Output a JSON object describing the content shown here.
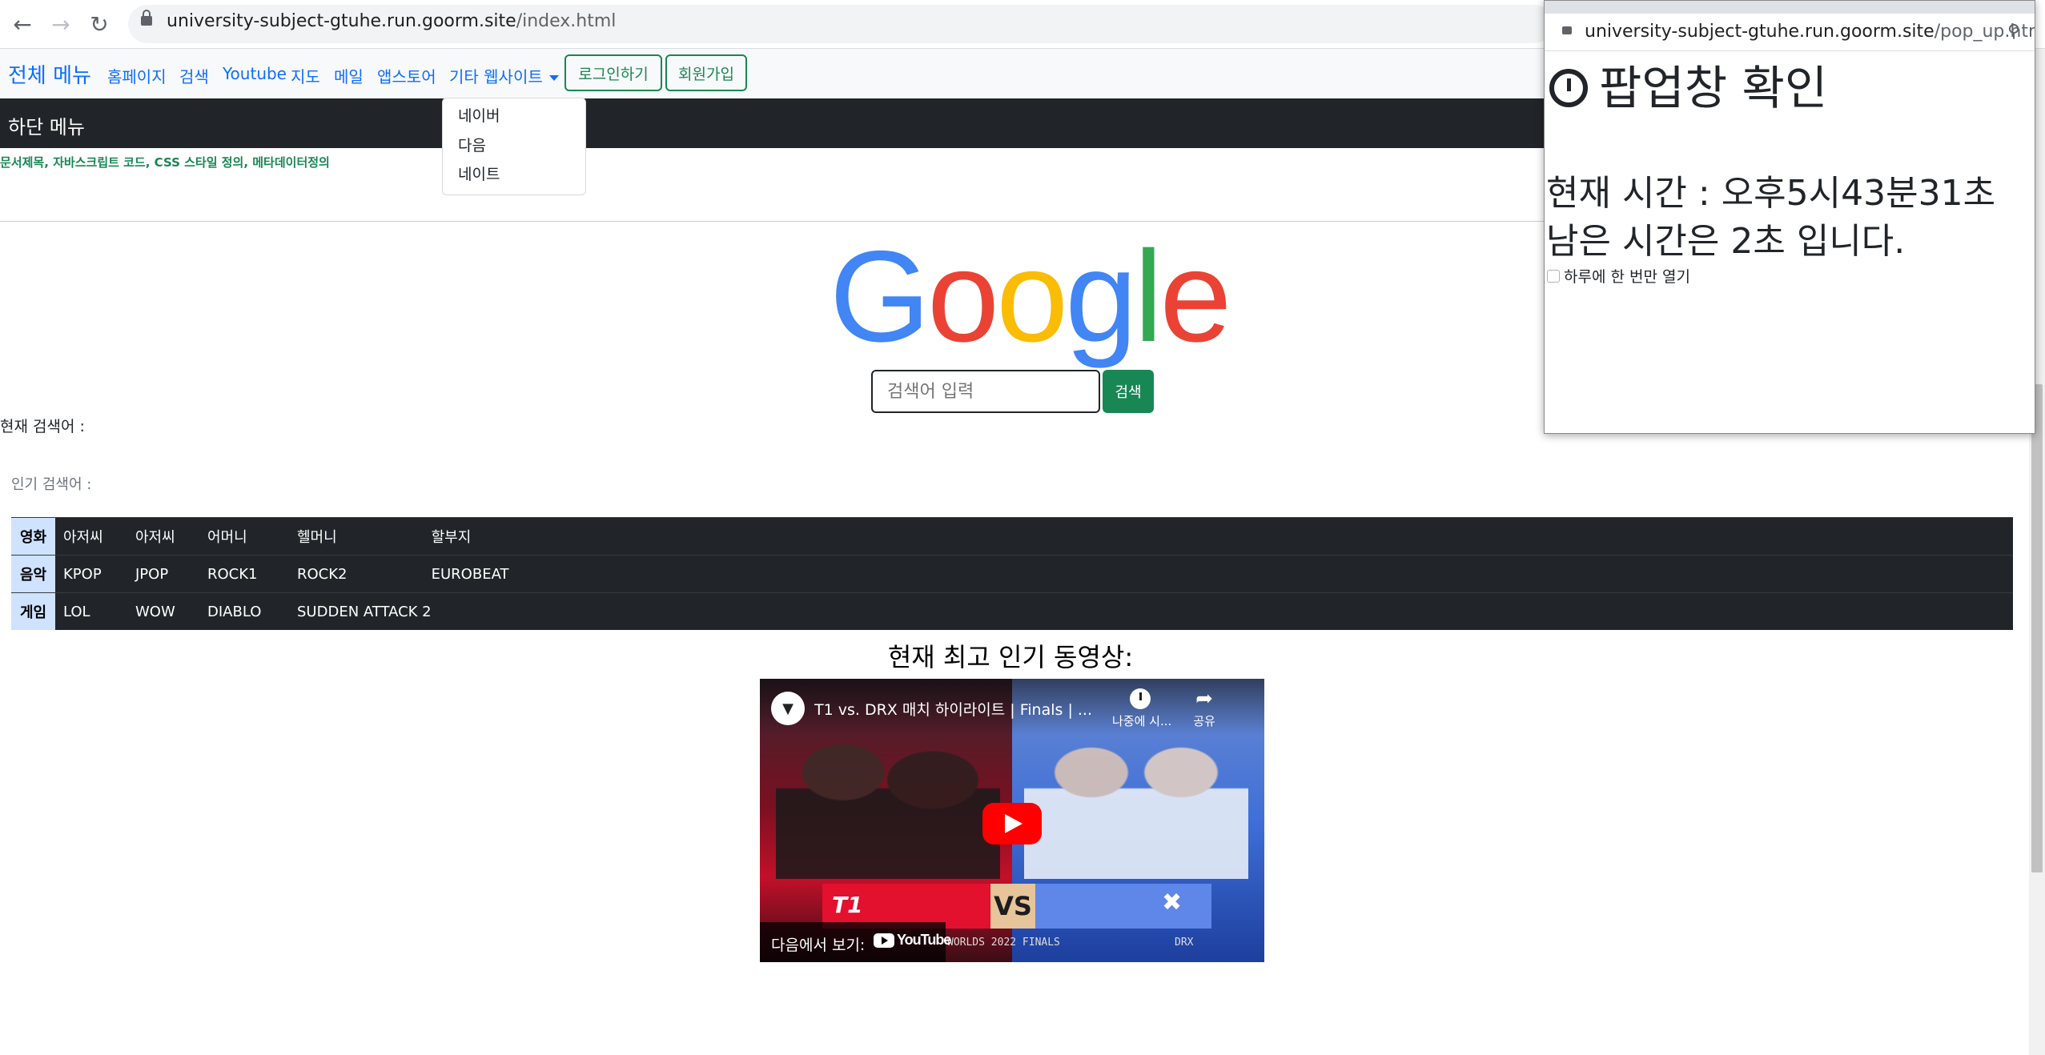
{
  "browser": {
    "url_host": "university-subject-gtuhe.run.goorm.site",
    "url_path": "/index.html"
  },
  "navbar": {
    "brand": "전체 메뉴",
    "links": [
      "홈페이지",
      "검색",
      "Youtube",
      "지도",
      "메일",
      "앱스토어"
    ],
    "dropdown_label": "기타 웹사이트",
    "login_button": "로그인하기",
    "signup_button": "회원가입",
    "dropdown_items": [
      "네이버",
      "다음",
      "네이트"
    ]
  },
  "dark_bar": {
    "title": "하단 메뉴"
  },
  "meta_text": "문서제목, 자바스크립트 코드, CSS 스타일 정의, 메타데이터정의",
  "google_logo": {
    "letters": [
      "G",
      "o",
      "o",
      "g",
      "l",
      "e"
    ],
    "colors": [
      "#4285F4",
      "#EA4335",
      "#FBBC05",
      "#4285F4",
      "#34A853",
      "#EA4335"
    ]
  },
  "search": {
    "placeholder": "검색어 입력",
    "button": "검색"
  },
  "current_keyword_label": "현재 검색어 :",
  "popular_keyword_label": "인기 검색어 :",
  "keyword_table": [
    {
      "category": "영화",
      "items": [
        "아저씨",
        "아저씨",
        "어머니",
        "헬머니",
        "할부지"
      ]
    },
    {
      "category": "음악",
      "items": [
        "KPOP",
        "JPOP",
        "ROCK1",
        "ROCK2",
        "EUROBEAT"
      ]
    },
    {
      "category": "게임",
      "items": [
        "LOL",
        "WOW",
        "DIABLO",
        "SUDDEN ATTACK 2",
        ""
      ]
    }
  ],
  "video_section_title": "현재 최고 인기 동영상:",
  "video": {
    "title": "T1 vs. DRX 매치 하이라이트 | Finals | ...",
    "watch_later": "나중에 시...",
    "share": "공유",
    "watch_on": "다음에서 보기:",
    "youtube": "YouTube",
    "team_left": "T1",
    "vs": "VS",
    "finals_text": "WORLDS 2022 FINALS",
    "team_right": "DRX"
  },
  "popup": {
    "url_host": "university-subject-gtuhe.run.goorm.site",
    "url_path": "/pop_up.html",
    "heading": "팝업창 확인",
    "time_text": "현재 시간 : 오후5시43분31초",
    "remain_text": "남은 시간은 2초 입니다.",
    "checkbox_label": "하루에 한 번만 열기"
  }
}
